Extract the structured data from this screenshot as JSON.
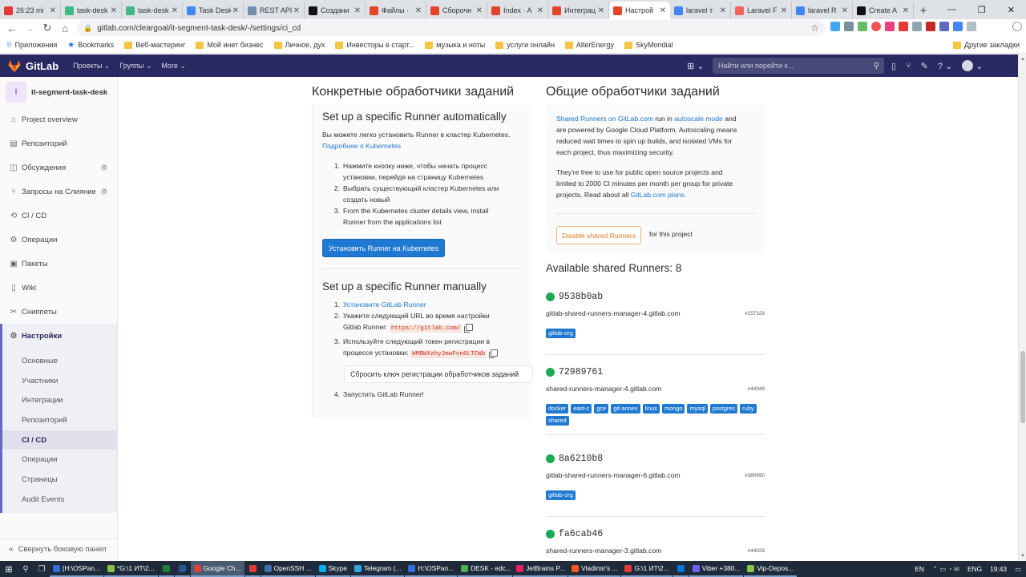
{
  "browser": {
    "tabs": [
      {
        "title": "26:23 mi",
        "color": "#e53935"
      },
      {
        "title": "task-desk",
        "color": "#41b883"
      },
      {
        "title": "task-desk",
        "color": "#41b883"
      },
      {
        "title": "Task Desk",
        "color": "#4285f4"
      },
      {
        "title": "REST API",
        "color": "#6f8faf"
      },
      {
        "title": "Создани",
        "color": "#111111"
      },
      {
        "title": "Файлы ·",
        "color": "#e24329"
      },
      {
        "title": "Сборочн",
        "color": "#e24329"
      },
      {
        "title": "Index · A",
        "color": "#e24329"
      },
      {
        "title": "Интеграц",
        "color": "#e24329"
      },
      {
        "title": "Настрой",
        "color": "#e24329",
        "active": true
      },
      {
        "title": "laravel т",
        "color": "#4285f4"
      },
      {
        "title": "Laravel F",
        "color": "#f4645f"
      },
      {
        "title": "laravel R",
        "color": "#4285f4"
      },
      {
        "title": "Create A",
        "color": "#111111"
      }
    ],
    "url": "gitlab.com/cleargoal/it-segment-task-desk/-/settings/ci_cd",
    "bookmarks": [
      {
        "label": "Приложения",
        "type": "apps"
      },
      {
        "label": "Bookmarks",
        "type": "star"
      },
      {
        "label": "Веб-мастеринг",
        "type": "folder"
      },
      {
        "label": "Мой инет бизнес",
        "type": "folder"
      },
      {
        "label": "Личное, дух",
        "type": "folder"
      },
      {
        "label": "Инвесторы в старт...",
        "type": "folder"
      },
      {
        "label": "музыка и ноты",
        "type": "folder"
      },
      {
        "label": "услуги онлайн",
        "type": "folder"
      },
      {
        "label": "AlterEnergy",
        "type": "folder"
      },
      {
        "label": "SkyMondial",
        "type": "folder"
      }
    ],
    "other_bookmarks": "Другие закладки"
  },
  "gitlab_nav": {
    "brand": "GitLab",
    "menu": [
      "Проекты ⌄",
      "Группы ⌄",
      "More ⌄"
    ],
    "search_placeholder": "Найти или перейти к..."
  },
  "sidebar": {
    "project_initial": "I",
    "project_name": "it-segment-task-desk",
    "items": [
      {
        "label": "Project overview",
        "icon": "home-icon",
        "glyph": "⌂"
      },
      {
        "label": "Репозиторий",
        "icon": "repo-icon",
        "glyph": "▤"
      },
      {
        "label": "Обсуждения",
        "icon": "issues-icon",
        "glyph": "◫",
        "badge": "0"
      },
      {
        "label": "Запросы на Слияние",
        "icon": "merge-request-icon",
        "glyph": "⑂",
        "badge": "0"
      },
      {
        "label": "CI / CD",
        "icon": "rocket-icon",
        "glyph": "⟲"
      },
      {
        "label": "Операции",
        "icon": "cloud-gear-icon",
        "glyph": "⚙"
      },
      {
        "label": "Пакеты",
        "icon": "package-icon",
        "glyph": "▣"
      },
      {
        "label": "Wiki",
        "icon": "book-icon",
        "glyph": "▯"
      },
      {
        "label": "Сниппеты",
        "icon": "scissors-icon",
        "glyph": "✂"
      },
      {
        "label": "Настройки",
        "icon": "settings-icon",
        "glyph": "⚙"
      }
    ],
    "sub_items": [
      "Основные",
      "Участники",
      "Интеграции",
      "Репозиторий",
      "CI / CD",
      "Операции",
      "Страницы",
      "Audit Events"
    ],
    "collapse_label": "Свернуть боковую панел"
  },
  "specific": {
    "heading": "Конкретные обработчики заданий",
    "auto_title": "Set up a specific Runner automatically",
    "auto_desc": "Вы можете легко установить Runner в кластер Kubernetes.",
    "auto_link": "Подробнее о Kubernetes",
    "auto_steps": [
      [
        "Нажмите кнопку ниже, чтобы начать процесс",
        "установки, перейдя на страницу Kubernetes"
      ],
      [
        "Выбрать существующий кластер Kubernetes или",
        "создать новый"
      ],
      [
        "From the Kubernetes cluster details view, install",
        "Runner from the applications list"
      ]
    ],
    "install_button": "Установить Runner на Kubernetes",
    "manual_title": "Set up a specific Runner manually",
    "step1_link": "Установите GitLab Runner",
    "step2_a": "Укажите следующий URL во время настройки",
    "step2_b": "Gitlab Runner:",
    "url_code": "https://gitlab.com/",
    "step3_a": "Используйте следующий токен регистрации в",
    "step3_b": "процессе установки:",
    "token_code": "WMBWXzhyJmwFvn6LTCWb",
    "reset_button": "Сбросить ключ регистрации обработчиков заданий",
    "step4": "Запустить GitLab Runner!"
  },
  "shared": {
    "heading": "Общие обработчики заданий",
    "p1_link1": "Shared Runners on GitLab.com",
    "p1_t1": " run in ",
    "p1_link2": "autoscale mode",
    "p1_t2": " and",
    "p1_lines": [
      "are powered by Google Cloud Platform. Autoscaling means",
      "reduced wait times to spin up builds, and isolated VMs for",
      "each project, thus maximizing security."
    ],
    "p2_lines": [
      "They're free to use for public open source projects and",
      "limited to 2000 CI minutes per month per group for private"
    ],
    "p2_last": "projects. Read about all ",
    "p2_link": "GitLab.com plans",
    "p2_end": ".",
    "disable_button": "Disable shared Runners",
    "for_project": "for this project",
    "available": "Available shared Runners: 8",
    "runners": [
      {
        "name": "9538b0ab",
        "host": "gitlab-shared-runners-manager-4.gitlab.com",
        "id": "#157329",
        "tags": [
          "gitlab-org"
        ]
      },
      {
        "name": "72989761",
        "host": "shared-runners-manager-4.gitlab.com",
        "id": "#44949",
        "tags": [
          "docker",
          "east-c",
          "gce",
          "git-annex",
          "linux",
          "mongo",
          "mysql",
          "postgres",
          "ruby",
          "shared"
        ]
      },
      {
        "name": "8a6210b8",
        "host": "gitlab-shared-runners-manager-6.gitlab.com",
        "id": "#380990",
        "tags": [
          "gitlab-org"
        ]
      },
      {
        "name": "fa6cab46",
        "host": "shared-runners-manager-3.gitlab.com",
        "id": "#44028",
        "tags": []
      }
    ]
  },
  "taskbar": {
    "apps": [
      {
        "label": "[H:\\OSPan...",
        "color": "#2f6fd6"
      },
      {
        "label": "*G:\\1 ИТ\\2...",
        "color": "#8bc34a"
      },
      {
        "label": "",
        "color": "#1e7e34"
      },
      {
        "label": "",
        "color": "#2b579a"
      },
      {
        "label": "Google Ch...",
        "color": "#db4437",
        "active": true
      },
      {
        "label": "",
        "color": "#e53935"
      },
      {
        "label": "OpenSSH ...",
        "color": "#3f6fb5"
      },
      {
        "label": "Skype",
        "color": "#00aff0"
      },
      {
        "label": "Telegram (...",
        "color": "#2ca5e0"
      },
      {
        "label": "H:\\OSPan...",
        "color": "#2f6fd6"
      },
      {
        "label": "DESK - edc...",
        "color": "#4caf50"
      },
      {
        "label": "JetBrains P...",
        "color": "#e91e63"
      },
      {
        "label": "Vladimir's ...",
        "color": "#ff5722"
      },
      {
        "label": "G:\\1 ИТ\\2...",
        "color": "#e53935"
      },
      {
        "label": "",
        "color": "#0078d7"
      },
      {
        "label": "Viber +380...",
        "color": "#7360f2"
      },
      {
        "label": "Vip-Depos...",
        "color": "#8bc34a"
      }
    ],
    "lang1": "EN",
    "lang2": "ENG",
    "time": "19:43"
  }
}
